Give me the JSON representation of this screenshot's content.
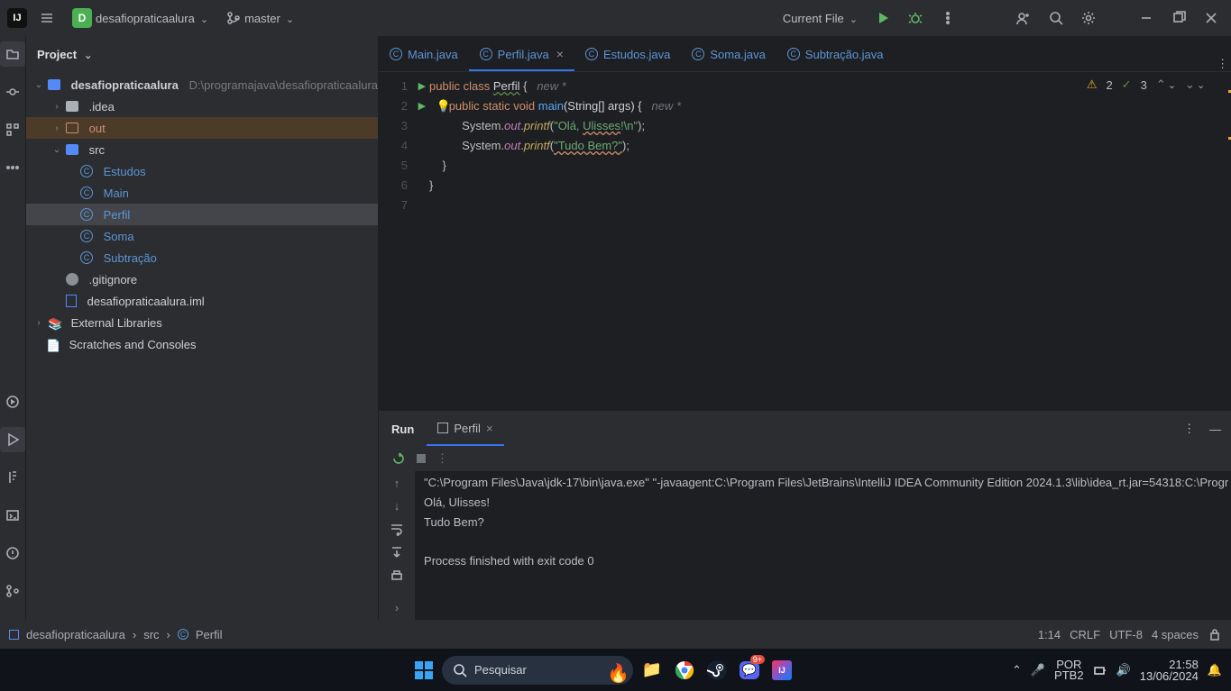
{
  "titlebar": {
    "project": "desafiopraticaalura",
    "projLetter": "D",
    "branch": "master",
    "runconf": "Current File"
  },
  "projectPanel": {
    "title": "Project"
  },
  "tree": {
    "rootName": "desafiopraticaalura",
    "rootPath": "D:\\programajava\\desafiopraticaalura",
    "idea": ".idea",
    "out": "out",
    "src": "src",
    "files": {
      "estudos": "Estudos",
      "main": "Main",
      "perfil": "Perfil",
      "soma": "Soma",
      "subtracao": "Subtração"
    },
    "gitignore": ".gitignore",
    "iml": "desafiopraticaalura.iml",
    "extlib": "External Libraries",
    "scratch": "Scratches and Consoles"
  },
  "tabs": [
    {
      "name": "Main.java"
    },
    {
      "name": "Perfil.java",
      "active": true
    },
    {
      "name": "Estudos.java"
    },
    {
      "name": "Soma.java"
    },
    {
      "name": "Subtração.java"
    }
  ],
  "inspection": {
    "warn": "2",
    "weak": "3"
  },
  "hints": {
    "new1": "new *",
    "new2": "new *"
  },
  "code": {
    "l1": {
      "kw1": "public",
      "kw2": "class",
      "cls": "Perfil",
      "brace": "{"
    },
    "l2": {
      "kw1": "public",
      "kw2": "static",
      "kw3": "void",
      "m": "main",
      "args": "(String[] args) {"
    },
    "l3": {
      "obj": "System.",
      "out": "out",
      "dot": ".",
      "fn": "printf",
      "open": "(",
      "s1": "\"Olá, ",
      "s2": "Ulisses",
      "s3": "!\\n\"",
      "close": ");"
    },
    "l4": {
      "obj": "System.",
      "out": "out",
      "dot": ".",
      "fn": "printf",
      "open": "(",
      "s1": "\"Tudo Bem?\"",
      "close": ");"
    },
    "l5": "    }",
    "l6": "}"
  },
  "run": {
    "title": "Run",
    "tab": "Perfil",
    "line1": "\"C:\\Program Files\\Java\\jdk-17\\bin\\java.exe\" \"-javaagent:C:\\Program Files\\JetBrains\\IntelliJ IDEA Community Edition 2024.1.3\\lib\\idea_rt.jar=54318:C:\\Progr",
    "line2": "Olá, Ulisses!",
    "line3": "Tudo Bem?",
    "line4": "Process finished with exit code 0"
  },
  "status": {
    "crumb1": "desafiopraticaalura",
    "crumb2": "src",
    "crumb3": "Perfil",
    "pos": "1:14",
    "eol": "CRLF",
    "enc": "UTF-8",
    "indent": "4 spaces"
  },
  "taskbar": {
    "search": "Pesquisar",
    "lang1": "POR",
    "lang2": "PTB2",
    "time": "21:58",
    "date": "13/06/2024"
  }
}
